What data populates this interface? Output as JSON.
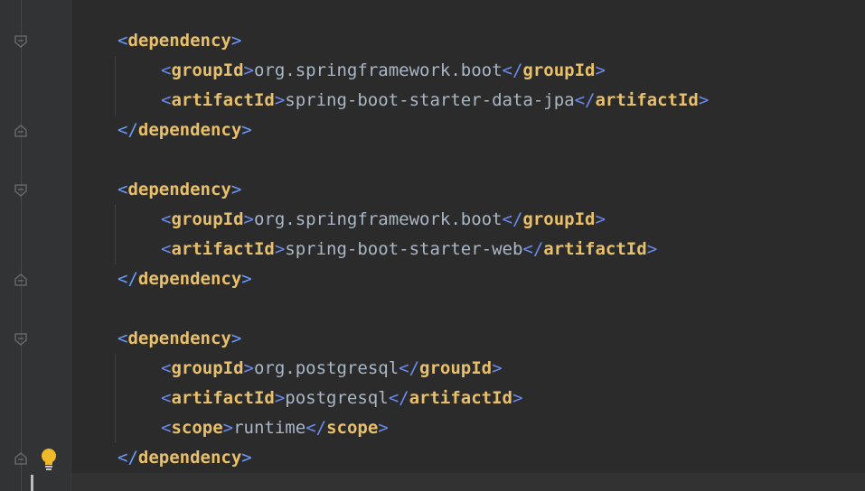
{
  "editor": {
    "lines": [
      {
        "indent": 1,
        "kind": "open",
        "tag": "dependency"
      },
      {
        "indent": 2,
        "kind": "element",
        "tag": "groupId",
        "value": "org.springframework.boot"
      },
      {
        "indent": 2,
        "kind": "element",
        "tag": "artifactId",
        "value": "spring-boot-starter-data-jpa"
      },
      {
        "indent": 1,
        "kind": "close",
        "tag": "dependency"
      },
      {
        "indent": 1,
        "kind": "open",
        "tag": "dependency"
      },
      {
        "indent": 2,
        "kind": "element",
        "tag": "groupId",
        "value": "org.springframework.boot"
      },
      {
        "indent": 2,
        "kind": "element",
        "tag": "artifactId",
        "value": "spring-boot-starter-web"
      },
      {
        "indent": 1,
        "kind": "close",
        "tag": "dependency"
      },
      {
        "indent": 1,
        "kind": "open",
        "tag": "dependency"
      },
      {
        "indent": 2,
        "kind": "element",
        "tag": "groupId",
        "value": "org.postgresql"
      },
      {
        "indent": 2,
        "kind": "element",
        "tag": "artifactId",
        "value": "postgresql"
      },
      {
        "indent": 2,
        "kind": "element",
        "tag": "scope",
        "value": "runtime"
      },
      {
        "indent": 1,
        "kind": "close",
        "tag": "dependency"
      }
    ]
  },
  "gutter": {
    "icons": [
      "fold-open-icon",
      "fold-close-icon",
      "lightbulb-icon"
    ]
  },
  "colors": {
    "background": "#2b2b2b",
    "gutter": "#313335",
    "bracket": "#6a8bf1",
    "tag": "#e8bf6a",
    "text": "#a9b7c6",
    "bulb": "#f0b92a"
  }
}
